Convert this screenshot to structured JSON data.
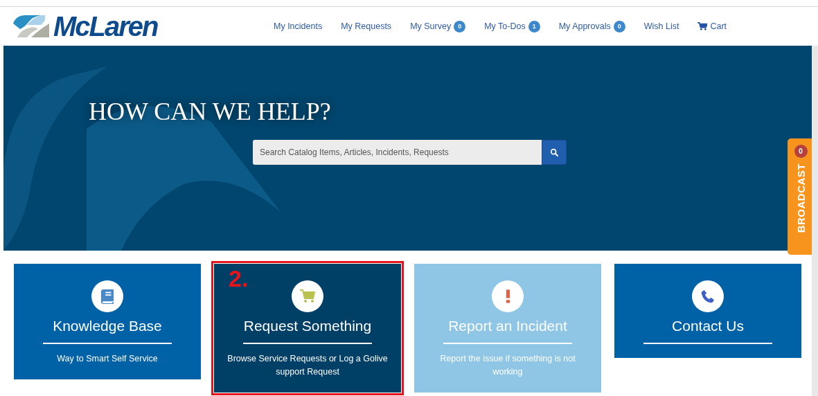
{
  "header": {
    "logo": "McLaren",
    "nav": [
      {
        "kind": "link",
        "label": "My Incidents"
      },
      {
        "kind": "link",
        "label": "My Requests"
      },
      {
        "kind": "badge",
        "label": "My Survey",
        "badge": "0"
      },
      {
        "kind": "badge",
        "label": "My To-Dos",
        "badge": "1"
      },
      {
        "kind": "badge",
        "label": "My Approvals",
        "badge": "0"
      },
      {
        "kind": "link",
        "label": "Wish List"
      },
      {
        "kind": "cart",
        "label": "Cart"
      }
    ]
  },
  "hero": {
    "title": "HOW CAN WE HELP?",
    "search": {
      "placeholder": "Search Catalog Items, Articles, Incidents, Requests"
    }
  },
  "broadcast": {
    "label": "BROADCAST",
    "count": "0"
  },
  "cards": [
    {
      "kind": "book",
      "title": "Knowledge Base",
      "subtitle": "Way to Smart Self Service",
      "color": "#0062a6"
    },
    {
      "kind": "cart",
      "title": "Request Something",
      "subtitle": "Browse Service Requests or Log a Golive support Request",
      "color": "#003f66",
      "annotation": "2."
    },
    {
      "kind": "alert",
      "title": "Report an Incident",
      "subtitle": "Report the issue if something is not working",
      "color": "#8fc6e6"
    },
    {
      "kind": "phone",
      "title": "Contact Us",
      "color": "#0062a6"
    }
  ]
}
